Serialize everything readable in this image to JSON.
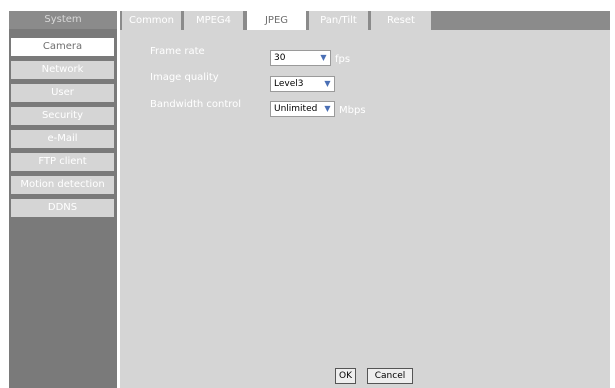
{
  "sidebar": {
    "header": "System",
    "items": [
      {
        "label": "Camera",
        "active": true
      },
      {
        "label": "Network"
      },
      {
        "label": "User"
      },
      {
        "label": "Security"
      },
      {
        "label": "e-Mail"
      },
      {
        "label": "FTP client"
      },
      {
        "label": "Motion detection"
      },
      {
        "label": "DDNS"
      }
    ]
  },
  "tabs": [
    {
      "label": "Common"
    },
    {
      "label": "MPEG4"
    },
    {
      "label": "JPEG",
      "active": true
    },
    {
      "label": "Pan/Tilt"
    },
    {
      "label": "Reset"
    }
  ],
  "form": {
    "frame_rate": {
      "label": "Frame rate",
      "value": "30",
      "unit": "fps"
    },
    "image_quality": {
      "label": "Image quality",
      "value": "Level3"
    },
    "bandwidth": {
      "label": "Bandwidth control",
      "value": "Unlimited",
      "unit": "Mbps"
    }
  },
  "buttons": {
    "ok": "OK",
    "cancel": "Cancel"
  },
  "colors": {
    "panel": "#d5d5d5",
    "sidebar_bg": "#7a7a7a",
    "header_bg": "#8b8b8b",
    "active": "#ffffff",
    "dropdown_arrow": "#4a6fb5"
  }
}
